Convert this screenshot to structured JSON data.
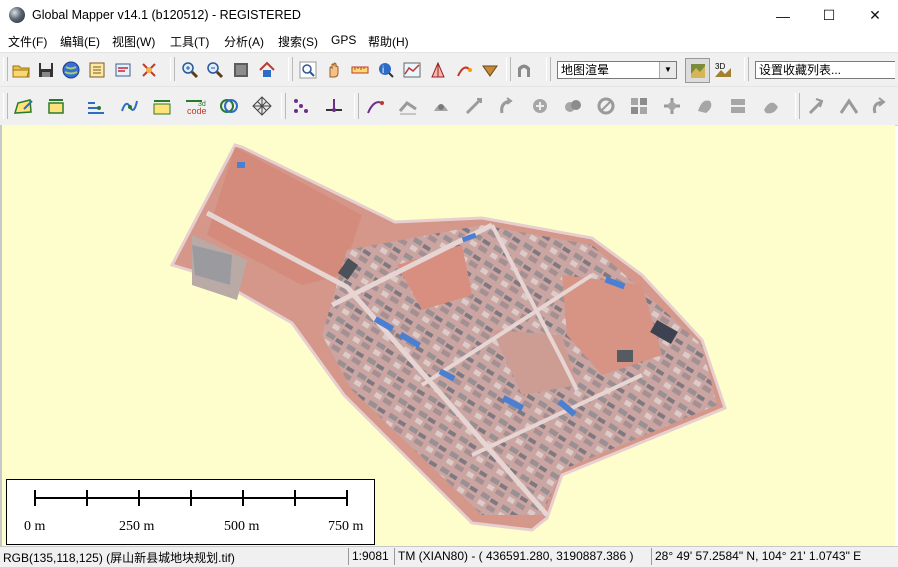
{
  "window": {
    "title": "Global Mapper v14.1 (b120512) - REGISTERED",
    "controls": {
      "minimize": "—",
      "maximize": "☐",
      "close": "✕"
    }
  },
  "menu": {
    "items": [
      "文件(F)",
      "编辑(E)",
      "视图(W)",
      "工具(T)",
      "分析(A)",
      "搜索(S)",
      "GPS",
      "帮助(H)"
    ]
  },
  "toolbar1": {
    "icons": [
      "open-folder-icon",
      "save-icon",
      "globe-icon",
      "layer-control-icon",
      "config-icon",
      "digitizer-tool-icon",
      "zoom-in-icon",
      "zoom-out-icon",
      "full-view-icon",
      "home-icon",
      "zoom-tool-icon",
      "pan-hand-icon",
      "measure-icon",
      "feature-info-icon",
      "path-profile-icon",
      "view-shed-icon",
      "3d-path-icon",
      "cut-fill-icon",
      "arch-tool-icon"
    ],
    "render_combo_value": "地图渲晕",
    "render_toggle_icons": [
      "shader-icon",
      "3d-view-icon"
    ],
    "bookmark_combo_value": "设置收藏列表..."
  },
  "toolbar2": {
    "icons": [
      "create-area-icon",
      "create-line-icon",
      "edit-vertices-icon",
      "reshape-icon",
      "split-icon",
      "code-icon",
      "combine-icon",
      "grid-icon",
      "pick-points-icon",
      "add-vertex-icon",
      "trace-icon",
      "d1-icon",
      "d2-icon",
      "d3-icon",
      "d4-icon",
      "d5-icon",
      "d6-icon",
      "d7-icon",
      "d8-icon",
      "d9-icon",
      "d10-icon",
      "d11-icon",
      "d12-icon",
      "d13-icon",
      "d14-icon",
      "d15-icon"
    ]
  },
  "map": {
    "background": "#fefdcc",
    "scale_bar": {
      "labels": [
        "0 m",
        "250 m",
        "500 m",
        "750 m"
      ]
    }
  },
  "statusbar": {
    "pixel_info": "RGB(135,118,125) (屏山新县城地块规划.tif)",
    "scale": "1:9081",
    "projection": "TM (XIAN80) - ( 436591.280, 3190887.386 )",
    "latlon": "28° 49' 57.2584\" N, 104° 21' 1.0743\" E"
  }
}
